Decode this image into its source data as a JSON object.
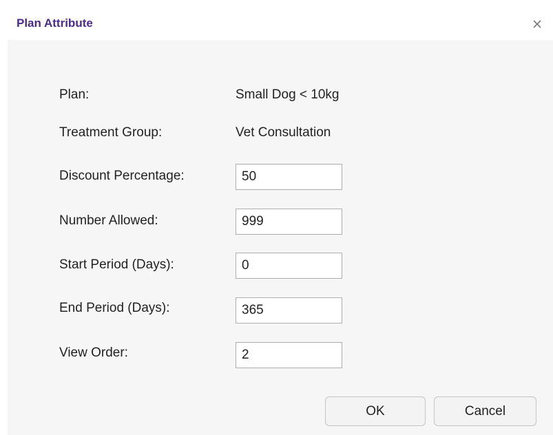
{
  "dialog": {
    "title": "Plan Attribute",
    "close_icon": "close-icon"
  },
  "form": {
    "plan": {
      "label": "Plan:",
      "value": "Small Dog < 10kg"
    },
    "treatment_group": {
      "label": "Treatment Group:",
      "value": "Vet Consultation"
    },
    "discount_percentage": {
      "label": "Discount Percentage:",
      "value": "50"
    },
    "number_allowed": {
      "label": "Number Allowed:",
      "value": "999"
    },
    "start_period": {
      "label": "Start Period (Days):",
      "value": "0"
    },
    "end_period": {
      "label": "End Period (Days):",
      "value": "365"
    },
    "view_order": {
      "label": "View Order:",
      "value": "2"
    }
  },
  "buttons": {
    "ok_label": "OK",
    "cancel_label": "Cancel"
  },
  "colors": {
    "title": "#4b2a91",
    "body_background": "#f6f6f6"
  }
}
